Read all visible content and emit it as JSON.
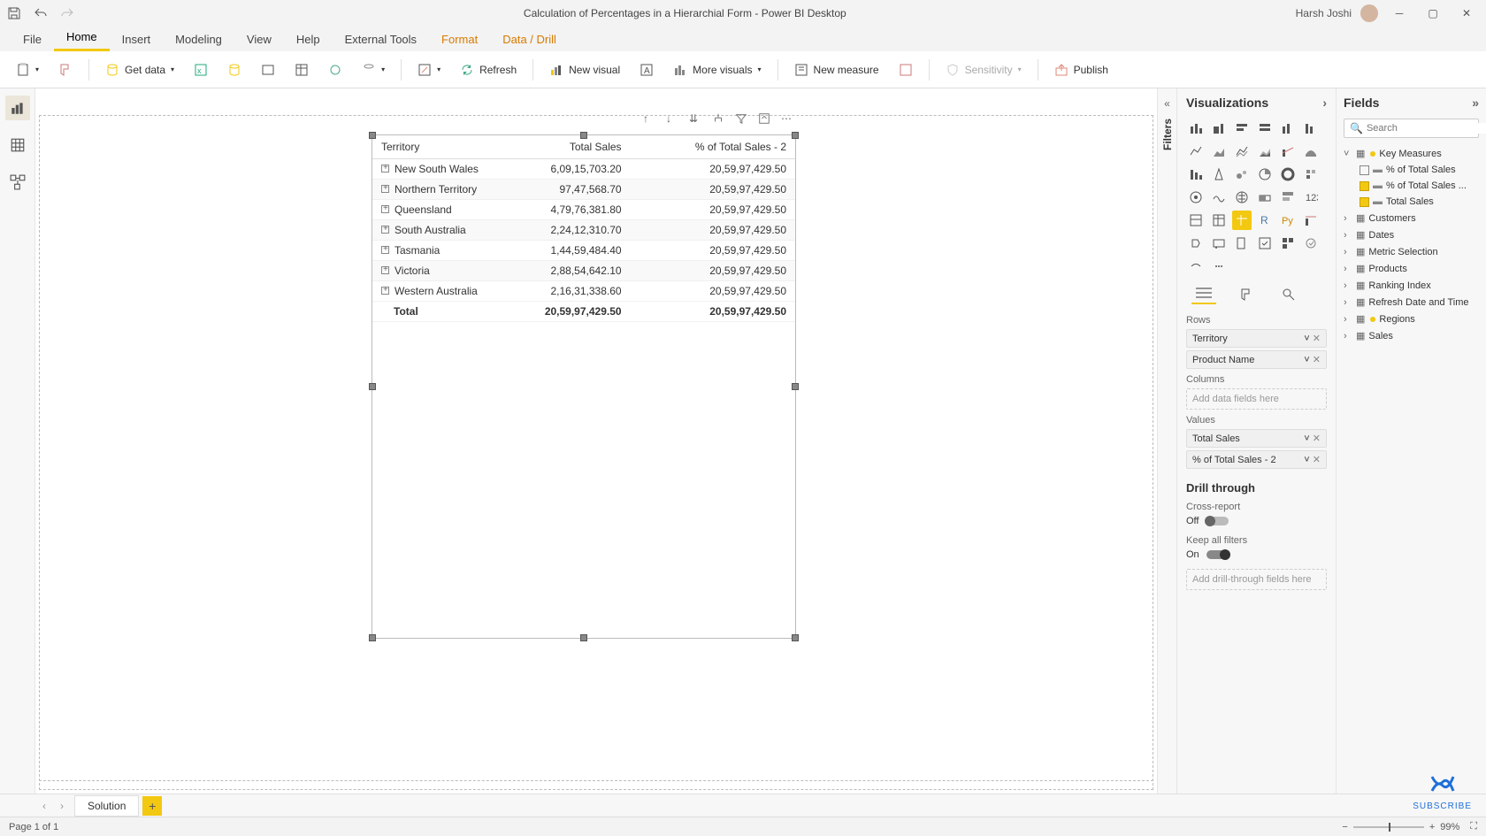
{
  "titlebar": {
    "file_title": "Calculation of Percentages in a Hierarchial Form - Power BI Desktop",
    "user_name": "Harsh Joshi"
  },
  "ribbon": {
    "tabs": [
      "File",
      "Home",
      "Insert",
      "Modeling",
      "View",
      "Help",
      "External Tools",
      "Format",
      "Data / Drill"
    ],
    "active_tab": "Home",
    "buttons": {
      "get_data": "Get data",
      "refresh": "Refresh",
      "new_visual": "New visual",
      "more_visuals": "More visuals",
      "new_measure": "New measure",
      "sensitivity": "Sensitivity",
      "publish": "Publish"
    }
  },
  "matrix": {
    "headers": [
      "Territory",
      "Total Sales",
      "% of Total Sales - 2"
    ],
    "rows": [
      {
        "territory": "New South Wales",
        "total": "6,09,15,703.20",
        "pct": "20,59,97,429.50"
      },
      {
        "territory": "Northern Territory",
        "total": "97,47,568.70",
        "pct": "20,59,97,429.50"
      },
      {
        "territory": "Queensland",
        "total": "4,79,76,381.80",
        "pct": "20,59,97,429.50"
      },
      {
        "territory": "South Australia",
        "total": "2,24,12,310.70",
        "pct": "20,59,97,429.50"
      },
      {
        "territory": "Tasmania",
        "total": "1,44,59,484.40",
        "pct": "20,59,97,429.50"
      },
      {
        "territory": "Victoria",
        "total": "2,88,54,642.10",
        "pct": "20,59,97,429.50"
      },
      {
        "territory": "Western Australia",
        "total": "2,16,31,338.60",
        "pct": "20,59,97,429.50"
      }
    ],
    "total_row": {
      "label": "Total",
      "total": "20,59,97,429.50",
      "pct": "20,59,97,429.50"
    }
  },
  "filters": {
    "label": "Filters"
  },
  "viz_pane": {
    "header": "Visualizations",
    "rows_label": "Rows",
    "rows": [
      "Territory",
      "Product Name"
    ],
    "columns_label": "Columns",
    "columns_placeholder": "Add data fields here",
    "values_label": "Values",
    "values": [
      "Total Sales",
      "% of Total Sales - 2"
    ],
    "drill_header": "Drill through",
    "cross_report_label": "Cross-report",
    "cross_report_state": "Off",
    "keep_filters_label": "Keep all filters",
    "keep_filters_state": "On",
    "drill_placeholder": "Add drill-through fields here"
  },
  "fields_pane": {
    "header": "Fields",
    "search_placeholder": "Search",
    "tables": [
      {
        "name": "Key Measures",
        "expanded": true,
        "calc": true,
        "fields": [
          {
            "name": "% of Total Sales",
            "checked": false,
            "calc": false
          },
          {
            "name": "% of Total Sales ...",
            "checked": true,
            "calc": false
          },
          {
            "name": "Total Sales",
            "checked": true,
            "calc": false
          }
        ]
      },
      {
        "name": "Customers",
        "expanded": false
      },
      {
        "name": "Dates",
        "expanded": false
      },
      {
        "name": "Metric Selection",
        "expanded": false
      },
      {
        "name": "Products",
        "expanded": false
      },
      {
        "name": "Ranking Index",
        "expanded": false
      },
      {
        "name": "Refresh Date and Time",
        "expanded": false
      },
      {
        "name": "Regions",
        "expanded": false,
        "calc": true
      },
      {
        "name": "Sales",
        "expanded": false
      }
    ]
  },
  "pages": {
    "tab": "Solution"
  },
  "status": {
    "page_info": "Page 1 of 1",
    "zoom": "99%"
  },
  "subscribe": "SUBSCRIBE"
}
